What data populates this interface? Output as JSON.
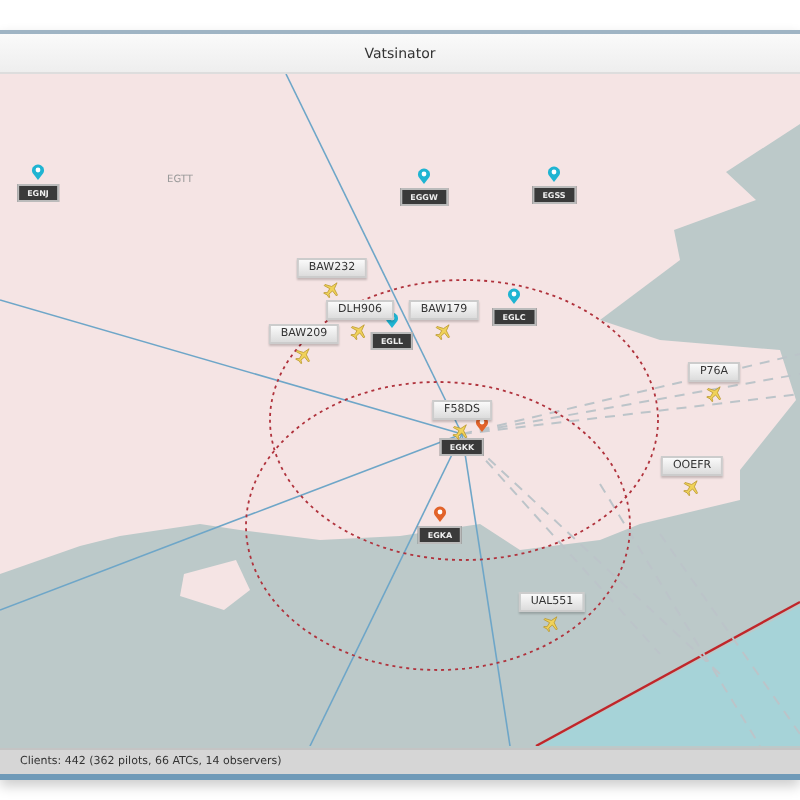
{
  "window": {
    "title": "Vatsinator"
  },
  "map": {
    "fir_label": "EGTT",
    "airports": [
      {
        "code": "EGNJ",
        "color": "#1fb4d2"
      },
      {
        "code": "EGGW",
        "color": "#1fb4d2"
      },
      {
        "code": "EGSS",
        "color": "#1fb4d2"
      },
      {
        "code": "EGLL",
        "color": "#1fb4d2"
      },
      {
        "code": "EGLC",
        "color": "#1fb4d2"
      },
      {
        "code": "EGKK",
        "color": "#e2632a"
      },
      {
        "code": "EGKA",
        "color": "#e2632a"
      }
    ],
    "pilots": [
      {
        "callsign": "BAW232"
      },
      {
        "callsign": "DLH906"
      },
      {
        "callsign": "BAW209"
      },
      {
        "callsign": "BAW179"
      },
      {
        "callsign": "F58DS"
      },
      {
        "callsign": "P76A"
      },
      {
        "callsign": "OOEFR"
      },
      {
        "callsign": "UAL551"
      }
    ]
  },
  "status_bar": "Clients: 442 (362 pilots, 66 ATCs, 14 observers)"
}
